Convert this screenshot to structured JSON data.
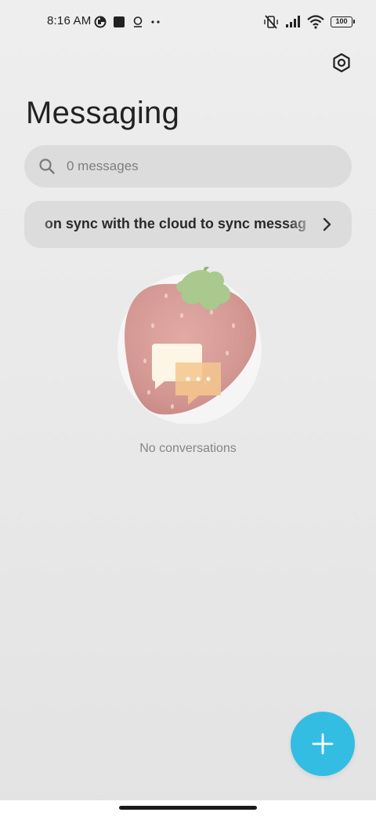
{
  "status_bar": {
    "time": "8:16 AM",
    "battery": "100"
  },
  "header": {
    "title": "Messaging"
  },
  "search": {
    "placeholder": "0 messages"
  },
  "sync_banner": {
    "text": "urn on sync with the cloud to sync messag"
  },
  "empty_state": {
    "text": "No conversations"
  },
  "colors": {
    "fab": "#33bde3",
    "background": "#ececec",
    "card": "#dcdcdc"
  },
  "icons": {
    "settings": "hexagon-gear-icon",
    "search": "search-icon",
    "chevron": "chevron-right-icon",
    "fab": "plus-icon"
  }
}
